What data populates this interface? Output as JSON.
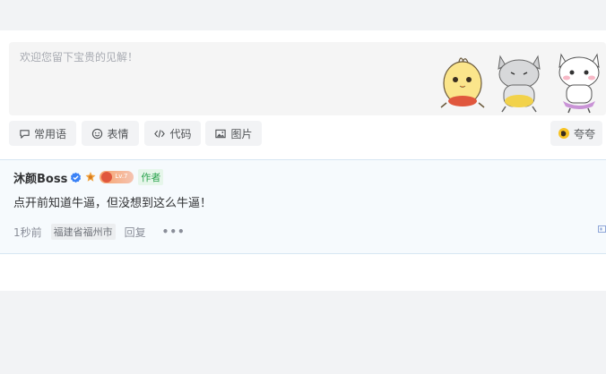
{
  "editor": {
    "placeholder": "欢迎您留下宝贵的见解！",
    "stickers": [
      "chick-sticker",
      "cat-grey-sticker",
      "cat-white-sticker"
    ]
  },
  "toolbar": {
    "phrases_label": "常用语",
    "emoji_label": "表情",
    "code_label": "代码",
    "image_label": "图片",
    "praise_label": "夸夸"
  },
  "comment": {
    "nickname": "沐颜Boss",
    "author_tag": "作者",
    "level_text": "Lv.7",
    "content": "点开前知道牛逼，但没想到这么牛逼！",
    "time": "1秒前",
    "location": "福建省福州市",
    "reply_label": "回复",
    "more_label": "•••"
  },
  "colors": {
    "page_bg": "#f2f3f5",
    "editor_bg": "#f5f5f5",
    "comment_bg": "#f6fafd",
    "author_tag": "#29a24c",
    "verified": "#3b82f6"
  }
}
